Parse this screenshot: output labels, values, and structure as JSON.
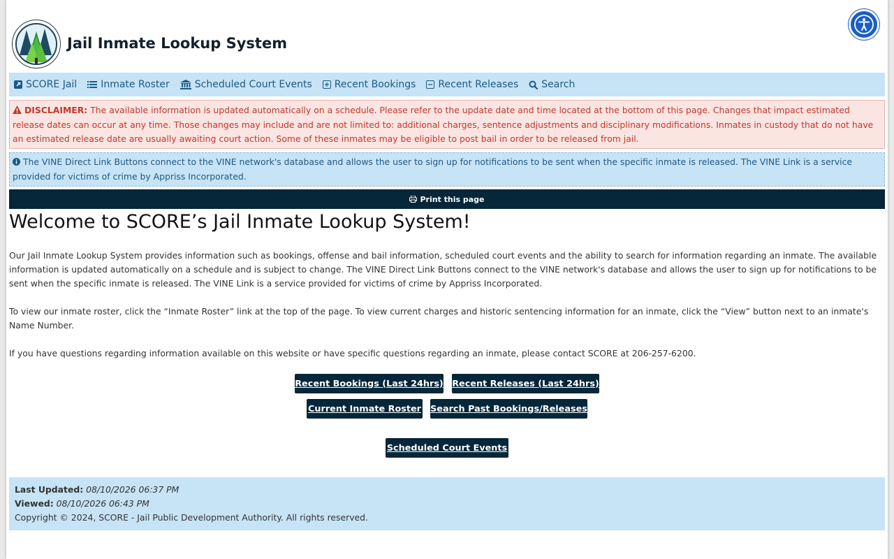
{
  "header": {
    "site_title": "Jail Inmate Lookup System"
  },
  "nav": {
    "items": [
      {
        "label": "SCORE Jail",
        "icon": "external-link-icon"
      },
      {
        "label": "Inmate Roster",
        "icon": "list-icon"
      },
      {
        "label": "Scheduled Court Events",
        "icon": "courthouse-icon"
      },
      {
        "label": "Recent Bookings",
        "icon": "plus-square-icon"
      },
      {
        "label": "Recent Releases",
        "icon": "minus-square-icon"
      },
      {
        "label": "Search",
        "icon": "search-icon"
      }
    ]
  },
  "disclaimer": {
    "label": "DISCLAIMER:",
    "text": "The available information is updated automatically on a schedule. Please refer to the update date and time located at the bottom of this page. Changes that impact estimated release dates can occur at any time. Those changes may include and are not limited to: additional charges, sentence adjustments and disciplinary modifications. Inmates in custody that do not have an estimated release date are usually awaiting court action. Some of these inmates may be eligible to post bail in order to be released from jail."
  },
  "vine_info": {
    "text": "The VINE Direct Link Buttons connect to the VINE network's database and allows the user to sign up for notifications to be sent when the specific inmate is released. The VINE Link is a service provided for victims of crime by Appriss Incorporated."
  },
  "print": {
    "label": "Print this page"
  },
  "main": {
    "welcome_title": "Welcome to SCORE’s Jail Inmate Lookup System!",
    "paragraph_1": "Our Jail Inmate Lookup System provides information such as bookings, offense and bail information, scheduled court events and the ability to search for information regarding an inmate. The available information is updated automatically on a schedule and is subject to change. The VINE Direct Link Buttons connect to the VINE network's database and allows the user to sign up for notifications to be sent when the specific inmate is released. The VINE Link is a service provided for victims of crime by Appriss Incorporated.",
    "paragraph_2": "To view our inmate roster, click the “Inmate Roster” link at the top of the page. To view current charges and historic sentencing information for an inmate, click the “View” button next to an inmate's Name Number.",
    "paragraph_3": "If you have questions regarding information available on this website or have specific questions regarding an inmate, please contact SCORE at 206-257-6200."
  },
  "buttons": {
    "recent_bookings": "Recent Bookings (Last 24hrs)",
    "recent_releases": "Recent Releases (Last 24hrs)",
    "current_roster": "Current Inmate Roster",
    "search_past": "Search Past Bookings/Releases",
    "court_events": "Scheduled Court Events"
  },
  "footer": {
    "last_updated_label": "Last Updated:",
    "last_updated_value": "08/10/2026 06:37 PM",
    "viewed_label": "Viewed:",
    "viewed_value": "08/10/2026 06:43 PM",
    "copyright": "Copyright © 2024, SCORE - Jail Public Development Authority. All rights reserved."
  },
  "colors": {
    "nav_bg": "#c7e3f6",
    "dark_navy": "#06263a",
    "disclaimer_bg": "#fbe5e3",
    "disclaimer_text": "#c0392b",
    "accessibility_blue": "#1a5ec8"
  }
}
